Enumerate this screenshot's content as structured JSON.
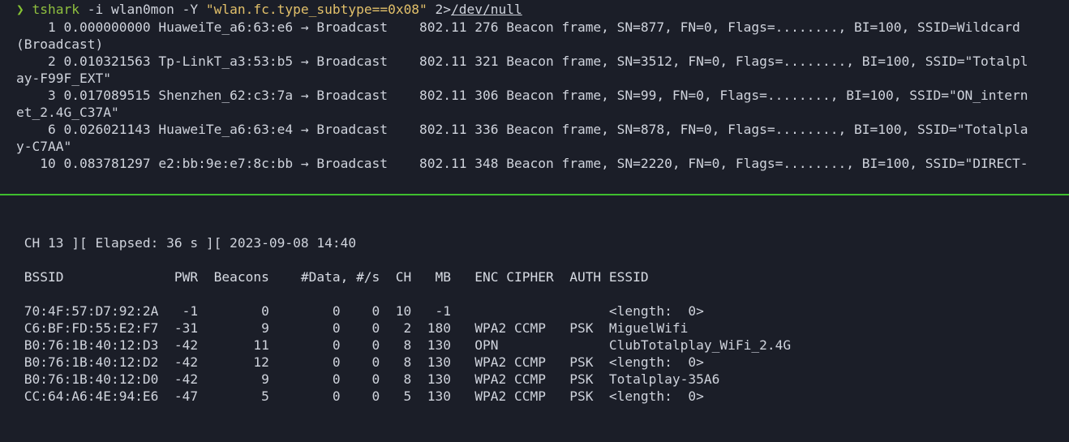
{
  "colors": {
    "background": "#1b1e28",
    "prompt": "#85c233",
    "string": "#e2c06a",
    "divider": "#3fbf2e",
    "text": "#cfd3dc"
  },
  "top": {
    "prompt_symbol": "❯",
    "command": "tshark",
    "args": " -i wlan0mon -Y ",
    "filter": "\"wlan.fc.type_subtype==0x08\"",
    "redirect": " 2>",
    "devnull": "/dev/null",
    "lines": [
      "    1 0.000000000 HuaweiTe_a6:63:e6 → Broadcast    802.11 276 Beacon frame, SN=877, FN=0, Flags=........, BI=100, SSID=Wildcard",
      "(Broadcast)",
      "    2 0.010321563 Tp-LinkT_a3:53:b5 → Broadcast    802.11 321 Beacon frame, SN=3512, FN=0, Flags=........, BI=100, SSID=\"Totalpl",
      "ay-F99F_EXT\"",
      "    3 0.017089515 Shenzhen_62:c3:7a → Broadcast    802.11 306 Beacon frame, SN=99, FN=0, Flags=........, BI=100, SSID=\"ON_intern",
      "et_2.4G_C37A\"",
      "    6 0.026021143 HuaweiTe_a6:63:e4 → Broadcast    802.11 336 Beacon frame, SN=878, FN=0, Flags=........, BI=100, SSID=\"Totalpla",
      "y-C7AA\"",
      "   10 0.083781297 e2:bb:9e:e7:8c:bb → Broadcast    802.11 348 Beacon frame, SN=2220, FN=0, Flags=........, BI=100, SSID=\"DIRECT-"
    ]
  },
  "bottom": {
    "status": " CH 13 ][ Elapsed: 36 s ][ 2023-09-08 14:40",
    "header": " BSSID              PWR  Beacons    #Data, #/s  CH   MB   ENC CIPHER  AUTH ESSID",
    "rows": [
      " 70:4F:57:D7:92:2A   -1        0        0    0  10   -1                    <length:  0>",
      " C6:BF:FD:55:E2:F7  -31        9        0    0   2  180   WPA2 CCMP   PSK  MiguelWifi",
      " B0:76:1B:40:12:D3  -42       11        0    0   8  130   OPN              ClubTotalplay_WiFi_2.4G",
      " B0:76:1B:40:12:D2  -42       12        0    0   8  130   WPA2 CCMP   PSK  <length:  0>",
      " B0:76:1B:40:12:D0  -42        9        0    0   8  130   WPA2 CCMP   PSK  Totalplay-35A6",
      " CC:64:A6:4E:94:E6  -47        5        0    0   5  130   WPA2 CCMP   PSK  <length:  0>"
    ]
  }
}
